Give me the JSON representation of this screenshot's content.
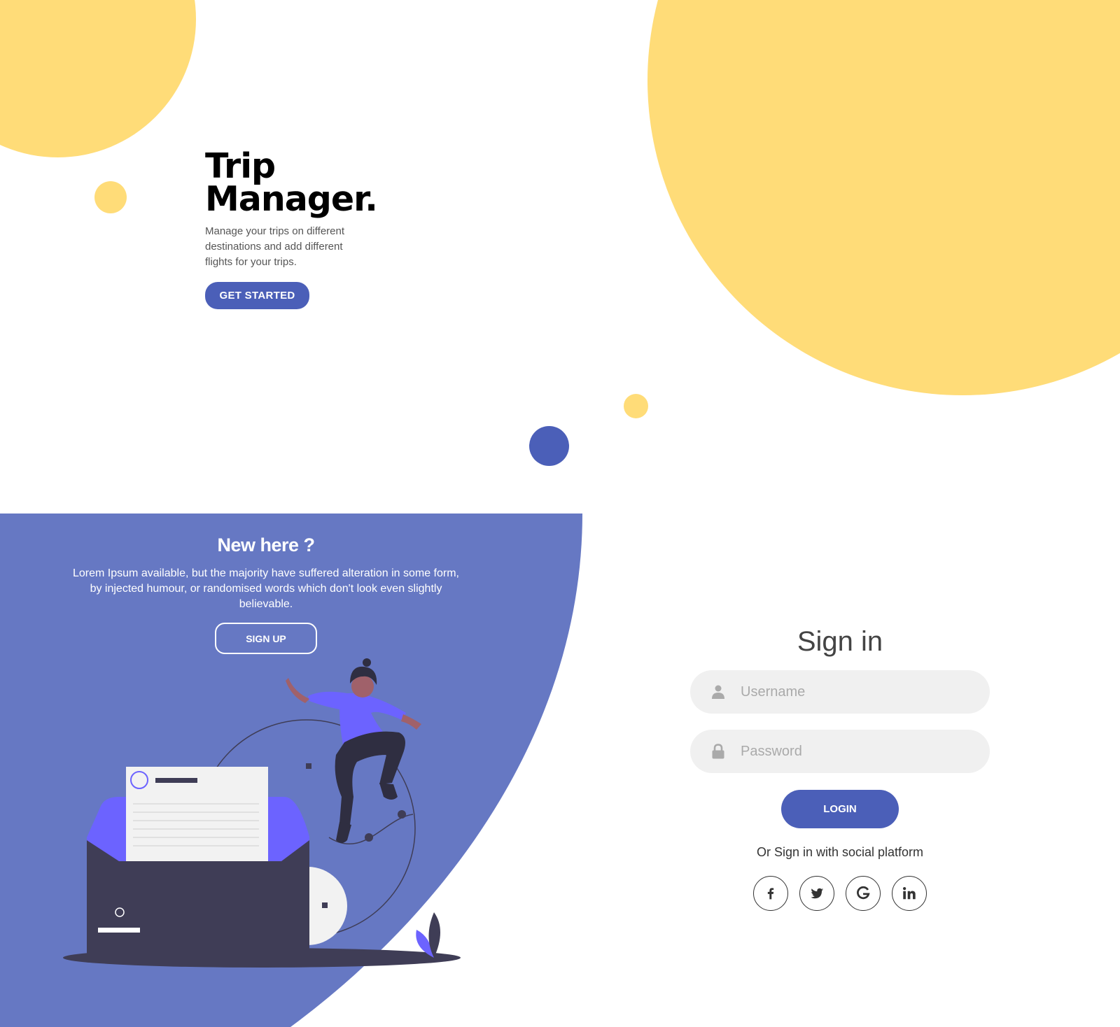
{
  "hero": {
    "title_line1": "Trip",
    "title_line2": "Manager.",
    "description": "Manage your trips on different destinations and add different flights for your trips.",
    "cta_label": "GET STARTED"
  },
  "signup_panel": {
    "heading": "New here ?",
    "text": "Lorem Ipsum available, but the majority have suffered alteration in some form, by injected humour, or randomised words which don't look even slightly believable.",
    "button_label": "SIGN UP"
  },
  "signin": {
    "heading": "Sign in",
    "username_placeholder": "Username",
    "password_placeholder": "Password",
    "login_label": "LOGIN",
    "social_text": "Or Sign in with social platform",
    "social_icons": [
      "facebook-icon",
      "twitter-icon",
      "google-icon",
      "linkedin-icon"
    ]
  },
  "colors": {
    "accent": "#4b5fb8",
    "panel": "#6678c3",
    "yellow": "#ffdc78",
    "illustration_purple": "#6c63ff",
    "illustration_dark": "#3f3d56"
  }
}
